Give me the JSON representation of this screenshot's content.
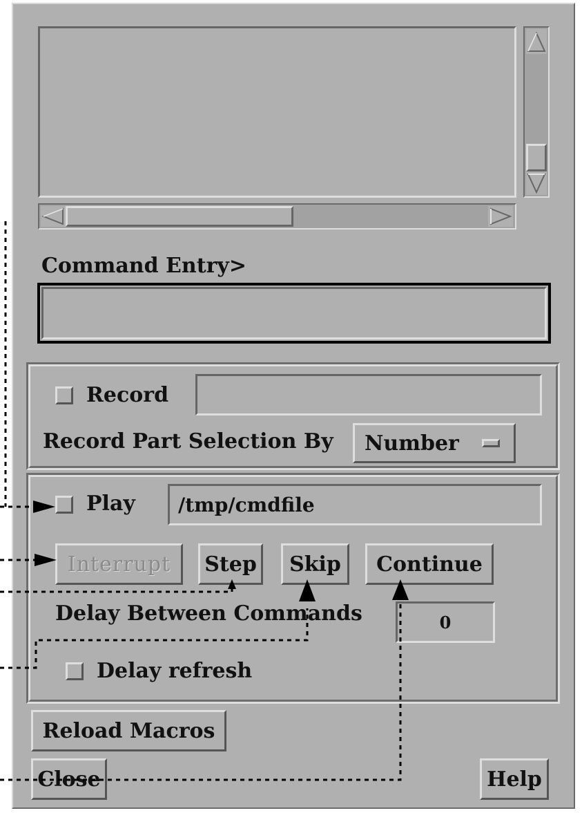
{
  "command_entry": {
    "label": "Command Entry>",
    "value": ""
  },
  "record": {
    "checkbox_label": "Record",
    "checked": false,
    "filename": ""
  },
  "record_part_selection": {
    "label": "Record Part Selection By",
    "selected": "Number"
  },
  "play": {
    "checkbox_label": "Play",
    "checked": false,
    "filename": "/tmp/cmdfile"
  },
  "controls": {
    "interrupt": "Interrupt",
    "step": "Step",
    "skip": "Skip",
    "continue": "Continue"
  },
  "delay": {
    "label": "Delay Between Commands",
    "value": "0"
  },
  "delay_refresh": {
    "label": "Delay refresh",
    "checked": false
  },
  "buttons": {
    "reload_macros": "Reload Macros",
    "close": "Close",
    "help": "Help"
  },
  "icons": [
    "up-arrow-icon",
    "down-arrow-icon",
    "left-arrow-icon",
    "right-arrow-icon",
    "option-menu-indicator-icon"
  ],
  "colors": {
    "panel": "#b0b0b0",
    "annotation": "#000000"
  }
}
